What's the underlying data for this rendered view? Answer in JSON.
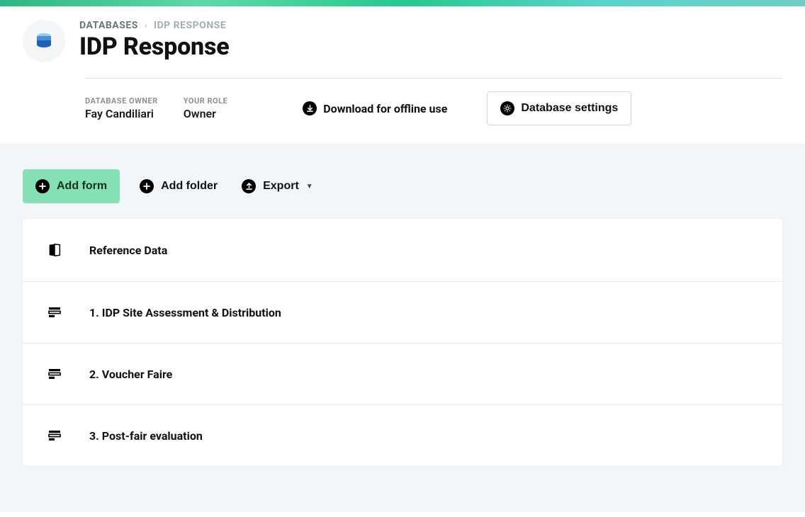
{
  "breadcrumb": {
    "root": "DATABASES",
    "current": "IDP RESPONSE"
  },
  "page_title": "IDP Response",
  "meta": {
    "owner_label": "DATABASE OWNER",
    "owner_value": "Fay Candiliari",
    "role_label": "YOUR ROLE",
    "role_value": "Owner"
  },
  "actions": {
    "download": "Download for offline use",
    "settings": "Database settings"
  },
  "toolbar": {
    "add_form": "Add form",
    "add_folder": "Add folder",
    "export": "Export"
  },
  "items": [
    {
      "label": "Reference Data",
      "type": "folder"
    },
    {
      "label": "1. IDP Site Assessment & Distribution",
      "type": "form"
    },
    {
      "label": "2. Voucher Faire",
      "type": "form"
    },
    {
      "label": "3. Post-fair evaluation",
      "type": "form"
    }
  ]
}
